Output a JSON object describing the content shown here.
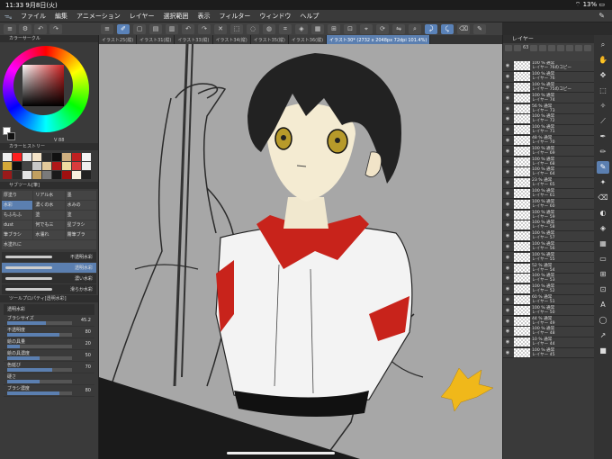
{
  "status": {
    "time": "11:33",
    "date": "9月8日(火)",
    "battery": "13%"
  },
  "menu": [
    "ファイル",
    "編集",
    "アニメーション",
    "レイヤー",
    "選択範囲",
    "表示",
    "フィルター",
    "ウィンドウ",
    "ヘルプ"
  ],
  "tabs": [
    "イラスト25(縦)",
    "イラスト31(縦)",
    "イラスト33(縦)",
    "イラスト34(縦)",
    "イラスト35(縦)",
    "イラスト36(縦)",
    "イラスト30* (2732 x 2048px 72dpi 101.4%)"
  ],
  "left": {
    "color_circle_label": "カラーサークル",
    "hsv_value": "88",
    "color_history_label": "カラーヒストリー",
    "history_colors": [
      "#f0f0f0",
      "#ff2020",
      "#e8e8e8",
      "#f5e4c8",
      "#2a2a2a",
      "#111111",
      "#d0b080",
      "#c02020",
      "#f5f5f5",
      "#d4a838",
      "#101010",
      "#444444",
      "#c8c8c8",
      "#e3c99a",
      "#b01818",
      "#f0dca0",
      "#d83c3c",
      "#eeeeee",
      "#9a1a1a",
      "#2d2d2d",
      "#e4e4e4",
      "#c2a060",
      "#7a7a7a",
      "#1a1a1a",
      "#a01010",
      "#f8f0e0",
      "#222222"
    ],
    "subtool_label": "サブツール[筆]",
    "subtools": [
      [
        "厚塗り",
        "リアル水",
        "墨"
      ],
      [
        "水彩",
        "濃くの水",
        "水みの"
      ],
      [
        "もふもふ",
        "塗",
        "塗"
      ],
      [
        "dust",
        "何でも三",
        "星ブラシ"
      ],
      [
        "筆ブラシ",
        "水濡れ",
        "霧筆ブラ"
      ],
      [
        "水塗れに"
      ]
    ],
    "brushes": [
      "不透明水彩",
      "透明水彩",
      "濃い水彩",
      "滑らか水彩"
    ],
    "tool_property_label": "ツールプロパティ[透明水彩]",
    "tool_property_name": "透明水彩",
    "props": [
      {
        "label": "ブラシサイズ",
        "value": "45.2",
        "fill": 0.6
      },
      {
        "label": "不透明度",
        "value": "80",
        "fill": 0.8
      },
      {
        "label": "絵の具量",
        "value": "20",
        "fill": 0.2
      },
      {
        "label": "絵の具濃度",
        "value": "50",
        "fill": 0.5
      },
      {
        "label": "色延び",
        "value": "70",
        "fill": 0.7
      },
      {
        "label": "硬さ",
        "value": "",
        "fill": 0.5
      },
      {
        "label": "ブラシ濃度",
        "value": "80",
        "fill": 0.8
      }
    ]
  },
  "right": {
    "layer_label": "レイヤー",
    "opacity": "63",
    "layers": [
      {
        "mode": "100 % 通常",
        "name": "レイヤー 76のコピー"
      },
      {
        "mode": "100 % 通常",
        "name": "レイヤー 76"
      },
      {
        "mode": "100 % 通常",
        "name": "レイヤー 75のコピー"
      },
      {
        "mode": "100 % 通常",
        "name": "レイヤー 74"
      },
      {
        "mode": "56 % 通常",
        "name": "レイヤー 73"
      },
      {
        "mode": "100 % 通常",
        "name": "レイヤー 72"
      },
      {
        "mode": "100 % 通常",
        "name": "レイヤー 71"
      },
      {
        "mode": "48 % 通常",
        "name": "レイヤー 70"
      },
      {
        "mode": "100 % 通常",
        "name": "レイヤー 69"
      },
      {
        "mode": "100 % 通常",
        "name": "レイヤー 68"
      },
      {
        "mode": "100 % 通常",
        "name": "レイヤー 64"
      },
      {
        "mode": "23 % 通常",
        "name": "レイヤー 65"
      },
      {
        "mode": "100 % 通常",
        "name": "レイヤー 61"
      },
      {
        "mode": "100 % 通常",
        "name": "レイヤー 60"
      },
      {
        "mode": "100 % 通常",
        "name": "レイヤー 59"
      },
      {
        "mode": "100 % 通常",
        "name": "レイヤー 58"
      },
      {
        "mode": "100 % 通常",
        "name": "レイヤー 57"
      },
      {
        "mode": "100 % 通常",
        "name": "レイヤー 56"
      },
      {
        "mode": "100 % 通常",
        "name": "レイヤー 55"
      },
      {
        "mode": "52 % 通常",
        "name": "レイヤー 54"
      },
      {
        "mode": "100 % 通常",
        "name": "レイヤー 53"
      },
      {
        "mode": "100 % 通常",
        "name": "レイヤー 52"
      },
      {
        "mode": "60 % 通常",
        "name": "レイヤー 51"
      },
      {
        "mode": "100 % 通常",
        "name": "レイヤー 50"
      },
      {
        "mode": "44 % 通常",
        "name": "レイヤー 49"
      },
      {
        "mode": "100 % 通常",
        "name": "レイヤー 48"
      },
      {
        "mode": "10 % 通常",
        "name": "レイヤー 44"
      },
      {
        "mode": "100 % 通常",
        "name": "レイヤー 45"
      }
    ]
  },
  "colors": {
    "accent": "#5b7fb0",
    "canvas": "#a7a7a7"
  }
}
